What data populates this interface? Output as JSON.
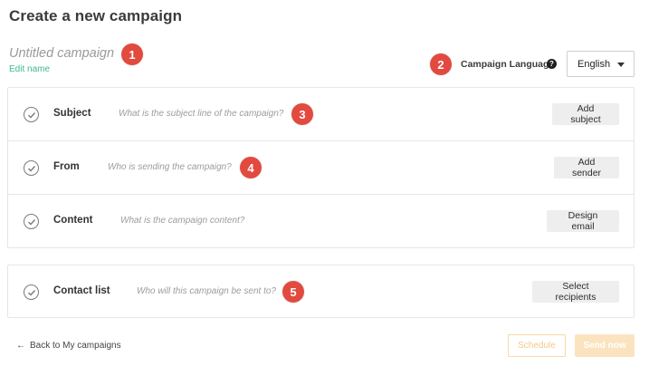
{
  "page": {
    "title": "Create a new campaign"
  },
  "campaign": {
    "name_placeholder": "Untitled campaign",
    "edit_name": "Edit name"
  },
  "language": {
    "label": "Campaign Language",
    "help_icon": "question-circle-icon",
    "selected": "English"
  },
  "markers": [
    "1",
    "2",
    "3",
    "4",
    "5"
  ],
  "sections": [
    {
      "label": "Subject",
      "description": "What is the subject line of the campaign?",
      "button": "Add subject",
      "icon": "check-circle-icon"
    },
    {
      "label": "From",
      "description": "Who is sending the campaign?",
      "button": "Add sender",
      "icon": "check-circle-icon"
    },
    {
      "label": "Content",
      "description": "What is the campaign content?",
      "button": "Design email",
      "icon": "check-circle-icon"
    },
    {
      "label": "Contact list",
      "description": "Who will this campaign be sent to?",
      "button": "Select recipients",
      "icon": "check-circle-icon"
    }
  ],
  "footer": {
    "back_link": "Back to My campaigns",
    "back_icon": "arrow-left-icon",
    "schedule": "Schedule",
    "send_now": "Send now"
  },
  "colors": {
    "accent_green": "#3fb98a",
    "marker_red": "#e24a3f",
    "send_button_disabled": "#fbe3bf",
    "schedule_border_disabled": "#f6d9a8"
  }
}
